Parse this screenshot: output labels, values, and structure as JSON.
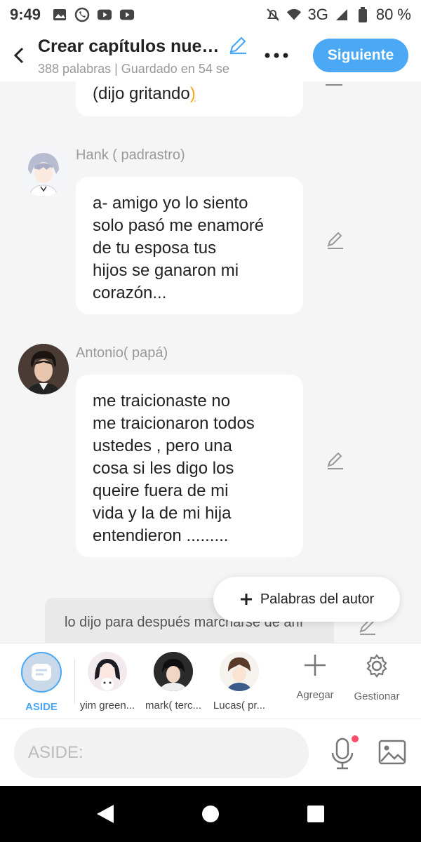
{
  "status": {
    "time": "9:49",
    "network": "3G",
    "battery": "80 %"
  },
  "header": {
    "title": "Crear capítulos nuev...",
    "subtitle": "388 palabras | Guardado en 54 se",
    "next_label": "Siguiente"
  },
  "chat": {
    "partial_message": "(dijo gritando",
    "partial_paren": ")",
    "messages": [
      {
        "sender": "Hank ( padrastro)",
        "lines": [
          "a- amigo yo lo siento",
          "solo pasó me enamoré",
          "de tu esposa tus",
          "hijos se ganaron mi",
          "corazón..."
        ]
      },
      {
        "sender": "Antonio( papá)",
        "lines": [
          "me traicionaste no",
          "me traicionaron todos",
          "ustedes , pero una",
          "cosa si les digo los",
          "queire fuera de mi",
          "vida y la de mi hija",
          "entendieron ........."
        ]
      }
    ],
    "aside_text": "lo dijo para después marcharse de ahí",
    "author_button": "Palabras del autor"
  },
  "characters": [
    {
      "name": "ASIDE",
      "active": true
    },
    {
      "name": "yim green...",
      "active": false
    },
    {
      "name": "mark( terc...",
      "active": false
    },
    {
      "name": "Lucas( pr...",
      "active": false
    }
  ],
  "tools": {
    "add_label": "Agregar",
    "manage_label": "Gestionar"
  },
  "input": {
    "placeholder": "ASIDE:"
  },
  "colors": {
    "accent": "#4aa8f5",
    "chat_bg": "#f5f5f5",
    "mic_dot": "#ff4d6a"
  }
}
